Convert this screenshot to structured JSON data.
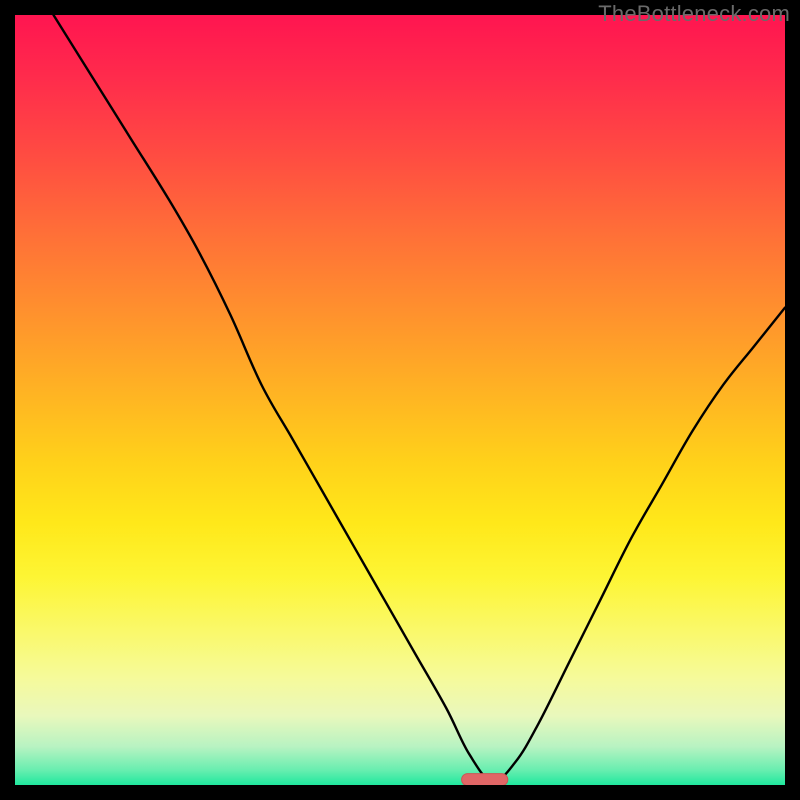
{
  "watermark": "TheBottleneck.com",
  "colors": {
    "frame": "#000000",
    "curve": "#000000",
    "marker_fill": "#e06666",
    "marker_stroke": "#cc5555",
    "gradient_top": "#ff1550",
    "gradient_bottom": "#20e89e"
  },
  "chart_data": {
    "type": "line",
    "title": "",
    "xlabel": "",
    "ylabel": "",
    "xlim": [
      0,
      100
    ],
    "ylim": [
      0,
      100
    ],
    "grid": false,
    "legend": false,
    "series": [
      {
        "name": "bottleneck-curve",
        "x": [
          5,
          10,
          15,
          20,
          24,
          28,
          32,
          36,
          40,
          44,
          48,
          52,
          56,
          59,
          62,
          65,
          68,
          72,
          76,
          80,
          84,
          88,
          92,
          96,
          100
        ],
        "values": [
          100,
          92,
          84,
          76,
          69,
          61,
          52,
          45,
          38,
          31,
          24,
          17,
          10,
          4,
          0.5,
          3,
          8,
          16,
          24,
          32,
          39,
          46,
          52,
          57,
          62
        ]
      }
    ],
    "annotations": [
      {
        "name": "optimal-marker",
        "type": "pill",
        "x_center": 61,
        "y": 0.7,
        "width": 6
      }
    ]
  }
}
